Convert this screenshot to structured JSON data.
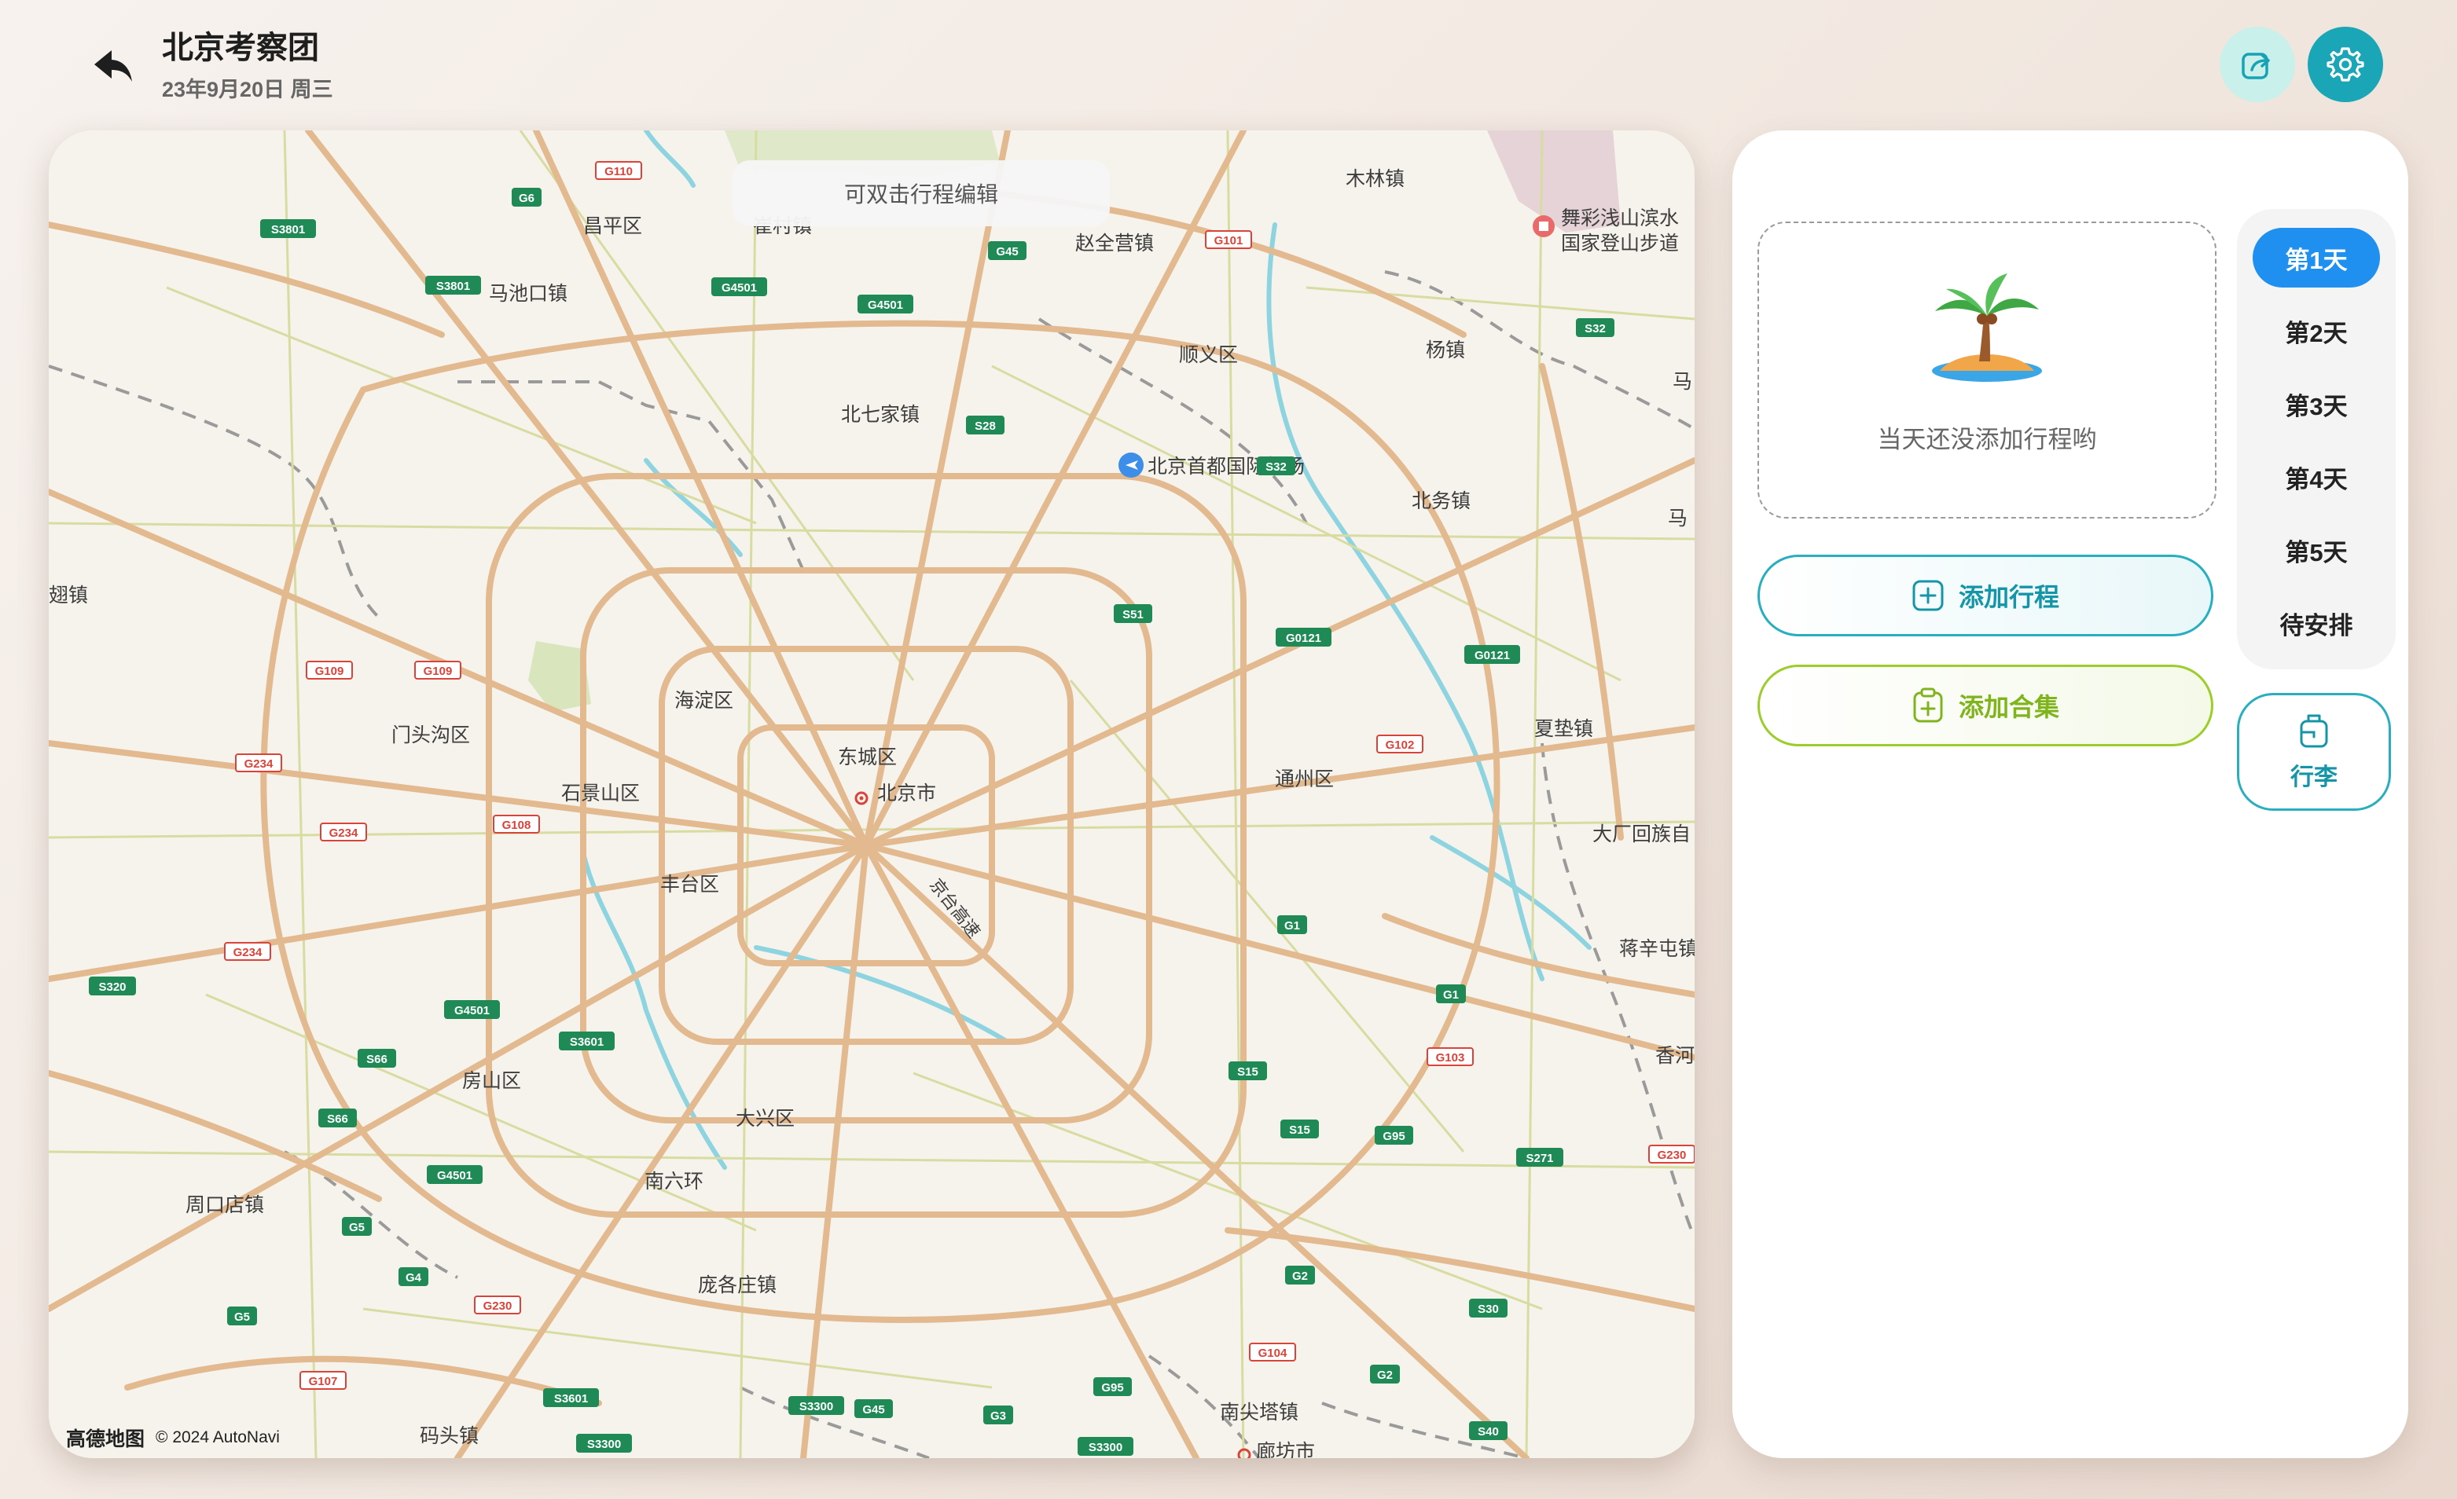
{
  "header": {
    "title": "北京考察团",
    "date": "23年9月20日 周三"
  },
  "map": {
    "hint": "可双击行程编辑",
    "provider": "高德地图",
    "copyright": "© 2024 AutoNavi",
    "labels": {
      "changping": "昌平区",
      "machikou": "马池口镇",
      "zhaoquanying": "赵全营镇",
      "mulin": "木林镇",
      "wucai": "舞彩浅山滨水",
      "guojia": "国家登山步道",
      "shunyi": "顺义区",
      "yang": "杨镇",
      "beiqijia": "北七家镇",
      "airport": "北京首都国际机场",
      "beiwu": "北务镇",
      "zhai": "翅镇",
      "haidian": "海淀区",
      "mentougou": "门头沟区",
      "dongcheng": "东城区",
      "shijingshan": "石景山区",
      "beijing": "北京市",
      "tongzhou": "通州区",
      "xiadian": "夏垫镇",
      "dachang": "大厂回族自",
      "fengtai": "丰台区",
      "jiangxintun": "蒋辛屯镇",
      "fangshan": "房山区",
      "daxing": "大兴区",
      "xianghe": "香河",
      "zhoukoudian": "周口店镇",
      "nanliuhuan": "南六环",
      "panggezhuang": "庞各庄镇",
      "nanjianta": "南尖塔镇",
      "matou": "码头镇",
      "langfang": "廊坊市",
      "cuicun": "崔村镇",
      "ma1": "马",
      "ma2": "马",
      "jingtai": "京台高速"
    },
    "shields": [
      "G110",
      "G6",
      "S3801",
      "S3801",
      "G4501",
      "G4501",
      "G45",
      "S28",
      "G101",
      "S32",
      "S32",
      "S51",
      "G0121",
      "G0121",
      "G102",
      "G109",
      "G109",
      "G234",
      "G234",
      "G108",
      "G4501",
      "S3601",
      "G234",
      "S320",
      "S66",
      "S66",
      "G4501",
      "G5",
      "G4",
      "G5",
      "G230",
      "G107",
      "S3601",
      "S3300",
      "S3300",
      "G45",
      "G3",
      "S3300",
      "G95",
      "G104",
      "G2",
      "S30",
      "G2",
      "S40",
      "G1",
      "G1",
      "G103",
      "S15",
      "S15",
      "G95",
      "S271",
      "G230"
    ]
  },
  "panel": {
    "empty_text": "当天还没添加行程哟",
    "add_itinerary": "添加行程",
    "add_collection": "添加合集",
    "days": [
      "第1天",
      "第2天",
      "第3天",
      "第4天",
      "第5天",
      "待安排"
    ],
    "luggage": "行李"
  },
  "colors": {
    "primary": "#1f8ff0",
    "teal": "#1aa6b7",
    "green": "#9ccd2a",
    "road": "#e3b98f",
    "water": "#8ed4e0"
  }
}
